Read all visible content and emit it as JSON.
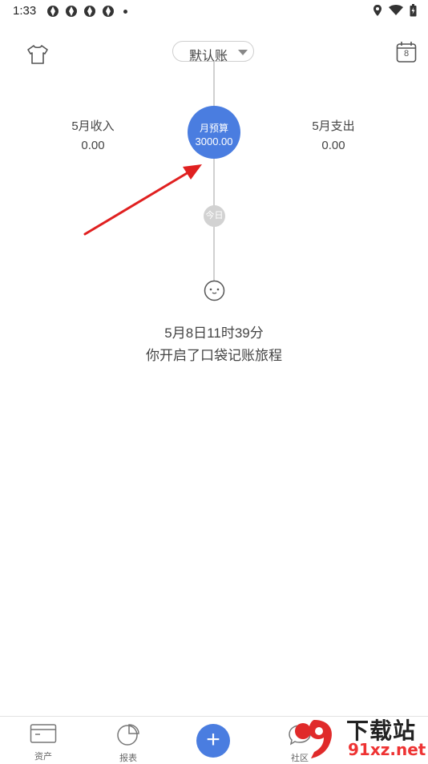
{
  "status_bar": {
    "time": "1:33"
  },
  "header": {
    "account_name": "默认账",
    "calendar_day": "8"
  },
  "summary": {
    "income_label": "5月收入",
    "income_value": "0.00",
    "expense_label": "5月支出",
    "expense_value": "0.00",
    "budget_label": "月预算",
    "budget_value": "3000.00",
    "today_label": "今日"
  },
  "timeline": {
    "start_date": "5月8日11时39分",
    "start_message": "你开启了口袋记账旅程"
  },
  "bottom_nav": {
    "items": [
      {
        "label": "资产"
      },
      {
        "label": "报表"
      },
      {
        "label": "+"
      },
      {
        "label": "社区"
      }
    ]
  },
  "watermark": {
    "top": "下载站",
    "bottom": "91xz.net"
  },
  "colors": {
    "accent": "#4a7de0",
    "annotation": "#e02020"
  }
}
